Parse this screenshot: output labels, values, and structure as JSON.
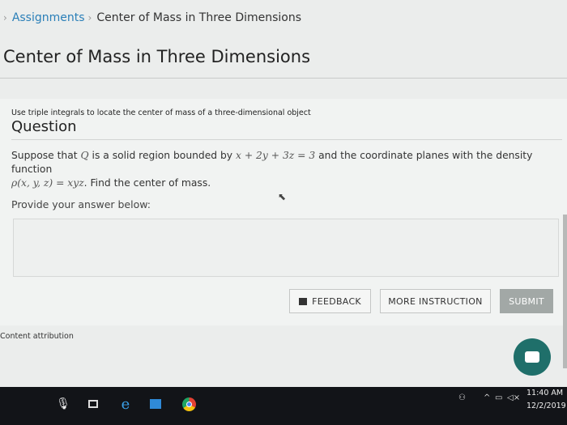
{
  "breadcrumb": {
    "items": [
      "Assignments",
      "Center of Mass in Three Dimensions"
    ]
  },
  "page": {
    "title": "Center of Mass in Three Dimensions"
  },
  "question": {
    "objective": "Use triple integrals to locate the center of mass of a three-dimensional object",
    "heading": "Question",
    "text_part1": "Suppose that",
    "var_q": "Q",
    "text_part2": "is a solid region bounded by",
    "plane_eq": "x + 2y + 3z = 3",
    "text_part3": "and the coordinate planes with the density function",
    "density_eq": "ρ(x, y, z) = xyz",
    "text_part4": ". Find the center of mass.",
    "provide_label": "Provide your answer below:"
  },
  "buttons": {
    "feedback": "FEEDBACK",
    "more_instruction": "MORE INSTRUCTION",
    "submit": "SUBMIT"
  },
  "footer": {
    "attribution": "Content attribution"
  },
  "taskbar": {
    "time": "11:40 AM",
    "date": "12/2/2019"
  },
  "colors": {
    "link": "#2a7fb8",
    "chat_button": "#1f6f6a",
    "submit_disabled": "#a2a8a6",
    "taskbar": "#121418"
  },
  "icons": [
    "chevron-right-icon",
    "flag-icon",
    "chat-icon",
    "microphone-icon",
    "task-view-icon",
    "edge-icon",
    "store-icon",
    "chrome-icon",
    "people-icon",
    "chevron-up-icon",
    "network-icon",
    "volume-icon",
    "cursor-icon"
  ]
}
